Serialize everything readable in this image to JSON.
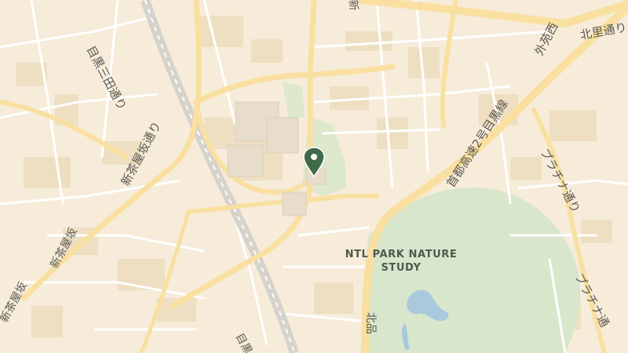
{
  "map": {
    "marker": {
      "color": "#3f6b48"
    },
    "park": {
      "line1": "NTL PARK NATURE",
      "line2": "STUDY"
    },
    "roads": {
      "meguro_mita": "目黒三田通り",
      "shinchaya_1": "新茶屋坂通り",
      "shinchaya_2": "新茶屋坂",
      "shinchaya_3": "新茶屋坂",
      "shuto_2": "首都高速2号目黒線",
      "gaien_nishi": "外苑西",
      "kitasato": "北里通り",
      "platina_1": "プラチナ通り",
      "platina_2": "プラチナ通",
      "kitashina": "北品",
      "meguro_bottom": "目黒",
      "top_cut": "新"
    },
    "colors": {
      "land": "#f6ecd9",
      "block": "#f1e2c6",
      "park": "#d8e6cc",
      "water": "#a9c9dc",
      "road_minor": "#ffffff",
      "road_major": "#fbe2a0",
      "rail": "#c9c6c2"
    }
  }
}
